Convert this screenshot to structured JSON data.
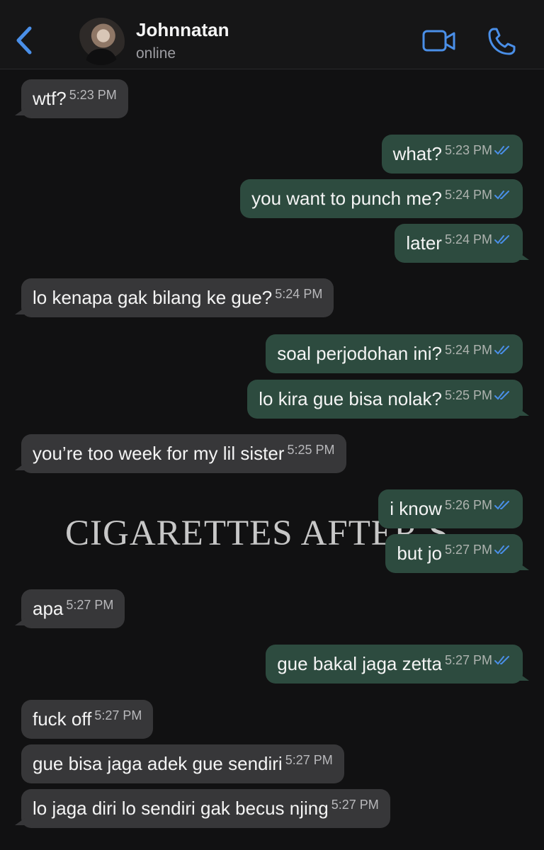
{
  "header": {
    "back_icon": "chevron-left-icon",
    "contact_name": "Johnnatan",
    "status": "online",
    "video_icon": "video-camera-icon",
    "call_icon": "phone-icon",
    "accent_color": "#4a8fe8"
  },
  "background_text": "CIGARETTES AFTER S",
  "messages": [
    {
      "direction": "incoming",
      "text": "wtf?",
      "time": "5:23 PM"
    },
    {
      "direction": "outgoing",
      "text": "what?",
      "time": "5:23 PM",
      "status": "read"
    },
    {
      "direction": "outgoing",
      "text": "you want to punch me?",
      "time": "5:24 PM",
      "status": "read"
    },
    {
      "direction": "outgoing",
      "text": "later",
      "time": "5:24 PM",
      "status": "read"
    },
    {
      "direction": "incoming",
      "text": "lo kenapa gak bilang ke gue?",
      "time": "5:24 PM"
    },
    {
      "direction": "outgoing",
      "text": "soal perjodohan ini?",
      "time": "5:24 PM",
      "status": "read"
    },
    {
      "direction": "outgoing",
      "text": "lo kira gue bisa nolak?",
      "time": "5:25 PM",
      "status": "read"
    },
    {
      "direction": "incoming",
      "text": "you’re too week for my lil sister",
      "time": "5:25 PM"
    },
    {
      "direction": "outgoing",
      "text": "i know",
      "time": "5:26 PM",
      "status": "read"
    },
    {
      "direction": "outgoing",
      "text": "but jo",
      "time": "5:27 PM",
      "status": "read"
    },
    {
      "direction": "incoming",
      "text": "apa",
      "time": "5:27 PM"
    },
    {
      "direction": "outgoing",
      "text": "gue bakal jaga zetta",
      "time": "5:27 PM",
      "status": "read"
    },
    {
      "direction": "incoming",
      "text": "fuck off",
      "time": "5:27 PM"
    },
    {
      "direction": "incoming",
      "text": "gue bisa jaga adek gue sendiri",
      "time": "5:27 PM"
    },
    {
      "direction": "incoming",
      "text": "lo jaga diri lo sendiri gak becus njing",
      "time": "5:27 PM"
    }
  ]
}
